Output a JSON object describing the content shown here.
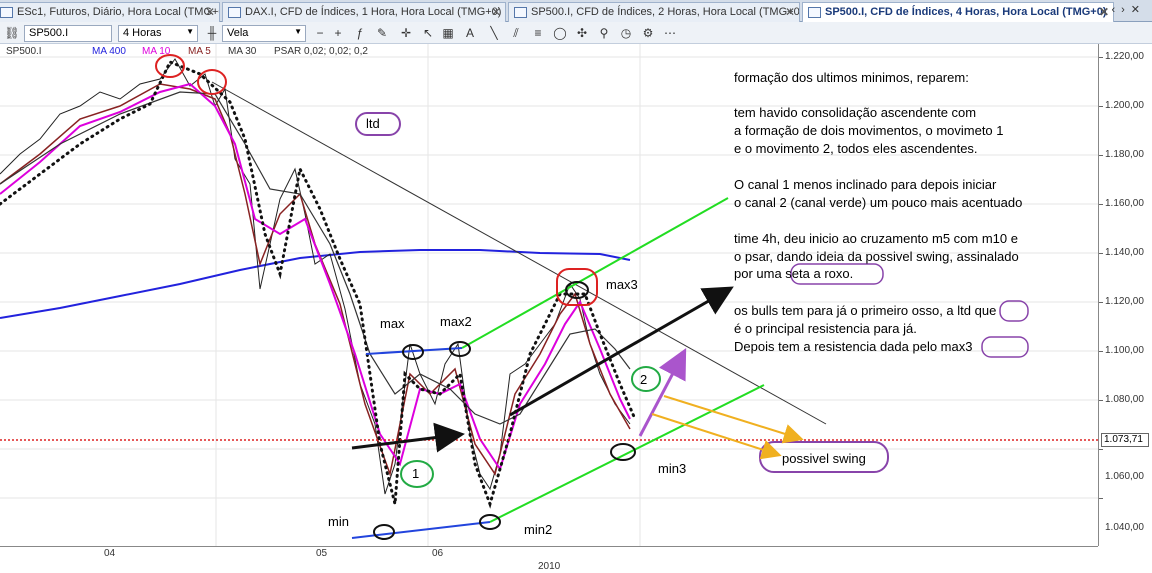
{
  "tabs": [
    {
      "label": "ESc1, Futuros, Diário, Hora Local (TMG+0)",
      "active": false
    },
    {
      "label": "DAX.I, CFD de Índices, 1 Hora, Hora Local (TMG+0)",
      "active": false
    },
    {
      "label": "SP500.I, CFD de Índices, 2 Horas, Hora Local (TMG+0)",
      "active": false
    },
    {
      "label": "SP500.I, CFD de Índices, 4 Horas, Hora Local (TMG+0)",
      "active": true
    }
  ],
  "toolbar": {
    "symbol": "SP500.I",
    "timeframe": "4 Horas",
    "chart_type": "Vela"
  },
  "indicators": {
    "symbol": "SP500.I",
    "ma400": "MA 400",
    "ma10": "MA 10",
    "ma5": "MA 5",
    "ma30": "MA 30",
    "psar": "PSAR 0,02; 0,02; 0,2"
  },
  "price_axis": {
    "labels": [
      "1.220,00",
      "1.200,00",
      "1.180,00",
      "1.160,00",
      "1.140,00",
      "1.120,00",
      "1.100,00",
      "1.080,00",
      "1.060,00",
      "1.040,00"
    ],
    "current": "1.073,71"
  },
  "time_axis": {
    "labels": [
      "04",
      "05",
      "06"
    ],
    "year": "2010"
  },
  "annotations": {
    "ltd": "ltd",
    "max": "max",
    "max2": "max2",
    "max3": "max3",
    "min": "min",
    "min2": "min2",
    "min3": "min3",
    "one": "1",
    "two": "2",
    "swing": "possivel swing"
  },
  "notes": {
    "l1": "formação dos ultimos minimos, reparem:",
    "l2": "tem havido consolidação ascendente com",
    "l3": "a formação de dois movimentos, o movimeto 1",
    "l4": "e o movimento 2, todos eles ascendentes.",
    "l5": "O canal 1 menos inclinado para depois iniciar",
    "l6": "o canal 2 (canal verde) um pouco mais acentuado",
    "l7": "time 4h, deu inicio ao cruzamento m5 com m10 e",
    "l8": "o psar, dando ideia da possivel swing, assinalado",
    "l9": "por uma seta a roxo.",
    "l10": "os bulls tem para já o primeiro osso, a ltd que",
    "l11": "é o principal resistencia para já.",
    "l12": "Depois tem a resistencia dada pelo max3"
  },
  "colors": {
    "ma400": "#2222dd",
    "ma10": "#dd00dd",
    "ma5": "#882222",
    "ma30": "#333333",
    "channel": "#22dd22",
    "channel1": "#2244dd",
    "circle_red": "#dd2222",
    "circle_green": "#22aa44",
    "circle_purple": "#8844aa",
    "arrow_yellow": "#f0b020",
    "arrow_purple": "#aa55cc"
  }
}
